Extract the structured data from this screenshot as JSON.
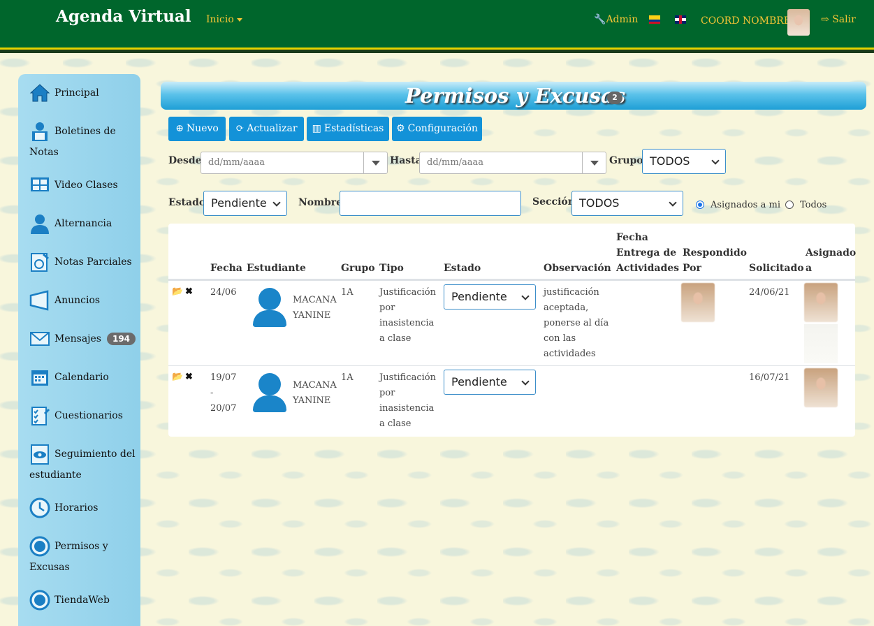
{
  "header": {
    "brand": "Agenda Virtual",
    "inicio": "Inicio",
    "admin": "Admin",
    "user": "COORD NOMBRES",
    "salir": "Salir"
  },
  "sidebar": {
    "items": [
      {
        "label": "Principal",
        "icon": "home-icon"
      },
      {
        "label": "Boletines de",
        "label2": "Notas",
        "icon": "report-icon"
      },
      {
        "label": "Video Clases",
        "icon": "video-icon"
      },
      {
        "label": "Alternancia",
        "icon": "user-icon"
      },
      {
        "label": "Notas Parciales",
        "icon": "grades-icon"
      },
      {
        "label": "Anuncios",
        "icon": "megaphone-icon"
      },
      {
        "label": "Mensajes",
        "badge": "194",
        "icon": "envelope-icon"
      },
      {
        "label": "Calendario",
        "icon": "calendar-icon"
      },
      {
        "label": "Cuestionarios",
        "icon": "checklist-icon"
      },
      {
        "label": "Seguimiento del",
        "label2": "estudiante",
        "icon": "eye-icon"
      },
      {
        "label": "Horarios",
        "icon": "clock-icon"
      },
      {
        "label": "Permisos y",
        "label2": "Excusas",
        "icon": "circle-icon"
      },
      {
        "label": "TiendaWeb",
        "icon": "circle-icon"
      }
    ]
  },
  "page": {
    "title": "Permisos y Excusas",
    "count": "2"
  },
  "toolbar": {
    "nuevo": "Nuevo",
    "actualizar": "Actualizar",
    "estadisticas": "Estadísticas",
    "configuracion": "Configuración"
  },
  "filters": {
    "desde_label": "Desde",
    "desde_placeholder": "dd/mm/aaaa",
    "hasta_label": "Hasta",
    "hasta_placeholder": "dd/mm/aaaa",
    "grupo_label": "Grupo",
    "grupo_value": "TODOS",
    "estado_label": "Estado",
    "estado_value": "Pendiente",
    "nombre_label": "Nombre",
    "nombre_value": "",
    "seccion_label": "Sección",
    "seccion_value": "TODOS",
    "radio_asignados": "Asignados a mi",
    "radio_todos": "Todos"
  },
  "table": {
    "headers": {
      "fecha": "Fecha",
      "estudiante": "Estudiante",
      "grupo": "Grupo",
      "tipo": "Tipo",
      "estado": "Estado",
      "observacion": "Observación",
      "fecha_entrega_1": "Fecha",
      "fecha_entrega_2": "Entrega de",
      "fecha_entrega_3": "Actividades",
      "respondido_1": "Respondido",
      "respondido_2": "Por",
      "solicitado": "Solicitado",
      "asignado_1": "Asignado",
      "asignado_2": "a"
    },
    "rows": [
      {
        "fecha_1": "24/06",
        "fecha_2": "",
        "fecha_3": "",
        "nombre_1": "MACANA",
        "nombre_2": "YANINE",
        "grupo": "1A",
        "tipo": [
          "Justificación",
          "por",
          "inasistencia",
          "a clase"
        ],
        "estado": "Pendiente",
        "observacion": [
          "justificación",
          "aceptada,",
          "ponerse al día",
          "con las",
          "actividades"
        ],
        "solicitado": "24/06/21"
      },
      {
        "fecha_1": "19/07",
        "fecha_2": "-",
        "fecha_3": "20/07",
        "nombre_1": "MACANA",
        "nombre_2": "YANINE",
        "grupo": "1A",
        "tipo": [
          "Justificación",
          "por",
          "inasistencia",
          "a clase"
        ],
        "estado": "Pendiente",
        "observacion": [],
        "solicitado": "16/07/21"
      }
    ]
  }
}
